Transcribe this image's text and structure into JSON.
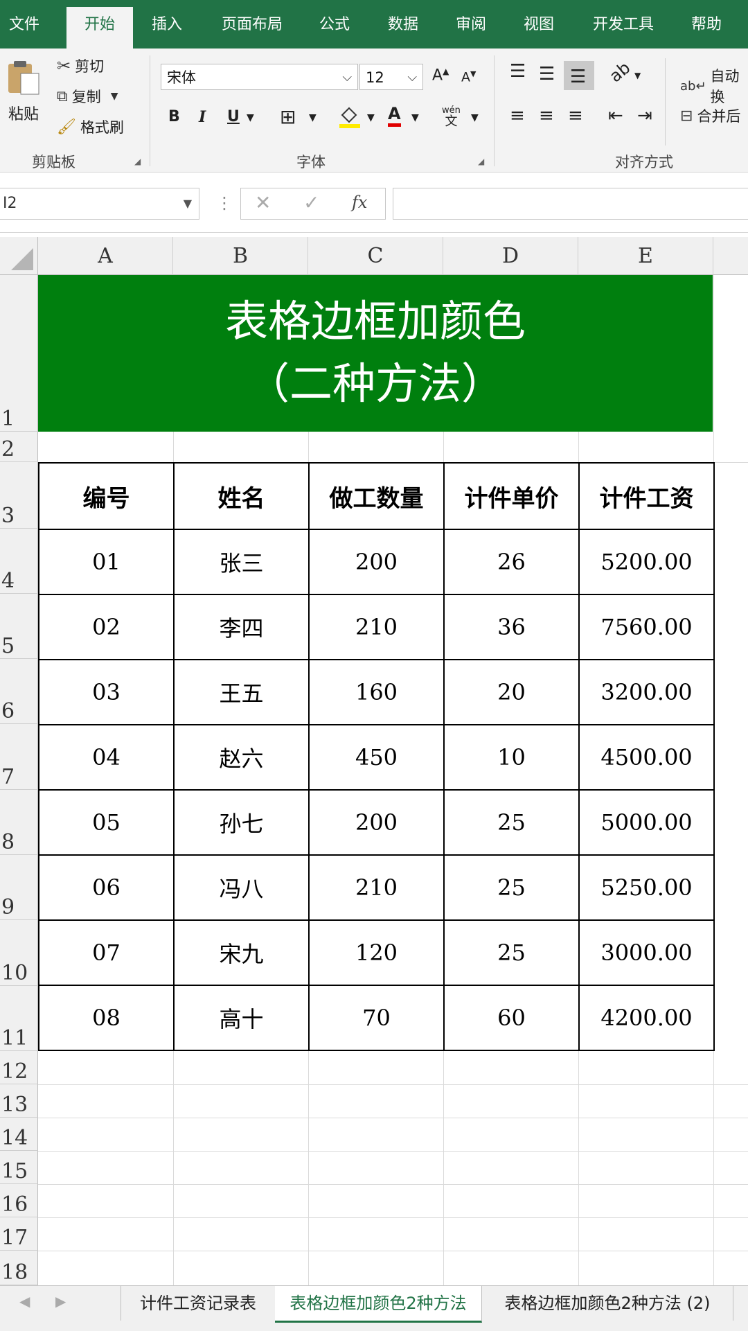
{
  "ribbon": {
    "tabs": [
      "文件",
      "开始",
      "插入",
      "页面布局",
      "公式",
      "数据",
      "审阅",
      "视图",
      "开发工具",
      "帮助"
    ],
    "clipboard": {
      "paste": "粘贴",
      "cut": "剪切",
      "copy": "复制",
      "painter": "格式刷",
      "label": "剪贴板"
    },
    "font": {
      "name": "宋体",
      "size": "12",
      "label": "字体",
      "bold": "B",
      "italic": "I",
      "underline": "U",
      "phonetic_top": "wén",
      "phonetic_bottom": "文"
    },
    "align": {
      "wrap": "自动换",
      "merge": "合并后",
      "label": "对齐方式"
    }
  },
  "formula": {
    "namebox": "I2",
    "fx": "fx"
  },
  "columns": [
    "A",
    "B",
    "C",
    "D",
    "E"
  ],
  "rows": [
    "1",
    "2",
    "3",
    "4",
    "5",
    "6",
    "7",
    "8",
    "9",
    "10",
    "11",
    "12",
    "13",
    "14",
    "15",
    "16",
    "17",
    "18"
  ],
  "title_line1": "表格边框加颜色",
  "title_line2": "（二种方法）",
  "headers": [
    "编号",
    "姓名",
    "做工数量",
    "计件单价",
    "计件工资"
  ],
  "table": [
    [
      "01",
      "张三",
      "200",
      "26",
      "5200.00"
    ],
    [
      "02",
      "李四",
      "210",
      "36",
      "7560.00"
    ],
    [
      "03",
      "王五",
      "160",
      "20",
      "3200.00"
    ],
    [
      "04",
      "赵六",
      "450",
      "10",
      "4500.00"
    ],
    [
      "05",
      "孙七",
      "200",
      "25",
      "5000.00"
    ],
    [
      "06",
      "冯八",
      "210",
      "25",
      "5250.00"
    ],
    [
      "07",
      "宋九",
      "120",
      "25",
      "3000.00"
    ],
    [
      "08",
      "高十",
      "70",
      "60",
      "4200.00"
    ]
  ],
  "sheets": [
    "计件工资记录表",
    "表格边框加颜色2种方法",
    "表格边框加颜色2种方法 (2)"
  ],
  "colors": {
    "excel_green": "#217346",
    "title_bg": "#007f0e"
  }
}
